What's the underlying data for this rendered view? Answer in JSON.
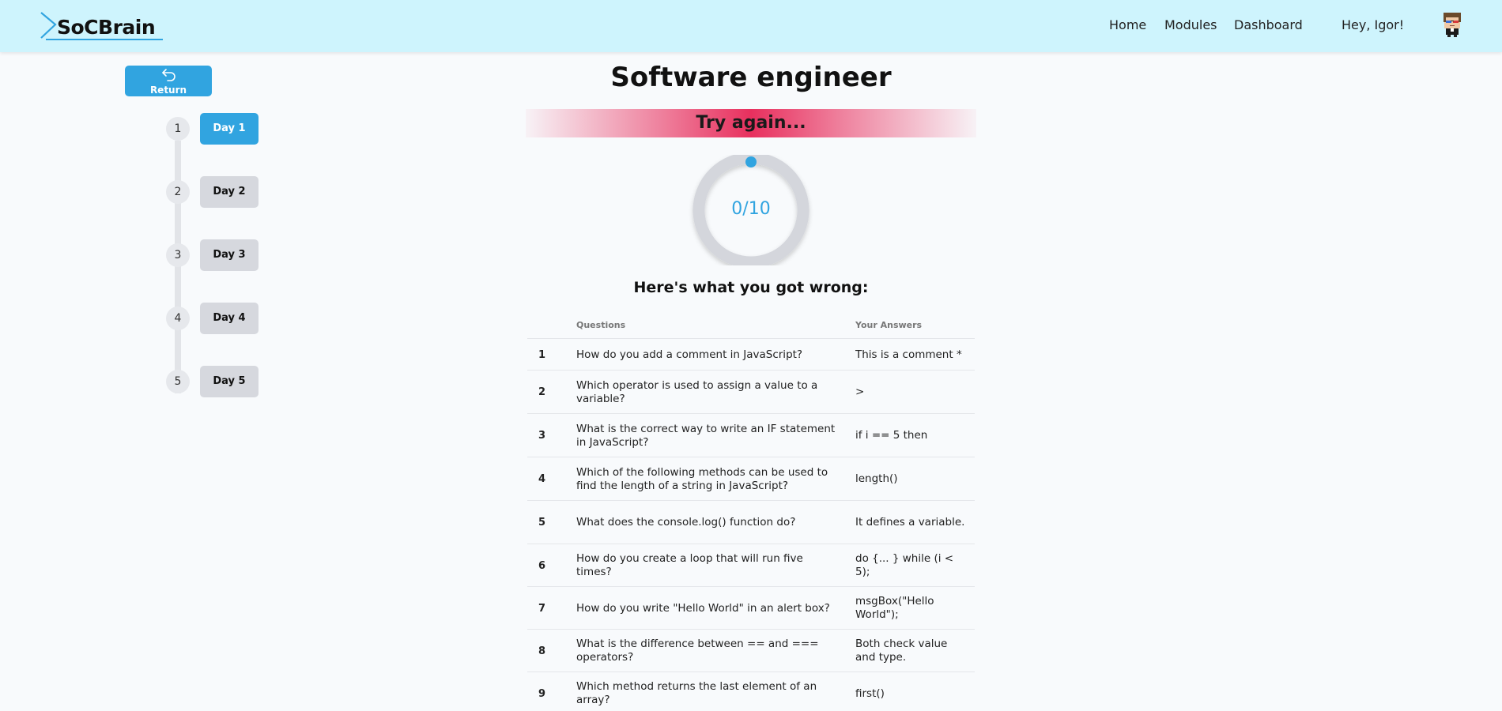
{
  "header": {
    "logo_text": "SoCBrain",
    "nav": [
      "Home",
      "Modules",
      "Dashboard"
    ],
    "greeting": "Hey, Igor!"
  },
  "return_label": "Return",
  "days": [
    {
      "num": "1",
      "label": "Day 1",
      "active": true
    },
    {
      "num": "2",
      "label": "Day 2",
      "active": false
    },
    {
      "num": "3",
      "label": "Day 3",
      "active": false
    },
    {
      "num": "4",
      "label": "Day 4",
      "active": false
    },
    {
      "num": "5",
      "label": "Day 5",
      "active": false
    }
  ],
  "title": "Software engineer",
  "banner": "Try again...",
  "score": {
    "text": "0/10",
    "correct": 0,
    "total": 10
  },
  "wrong_heading": "Here's what you got wrong:",
  "table": {
    "headers": {
      "questions": "Questions",
      "answers": "Your Answers"
    },
    "rows": [
      {
        "num": "1",
        "question": "How do you add a comment in JavaScript?",
        "answer": "This is a comment *"
      },
      {
        "num": "2",
        "question": "Which operator is used to assign a value to a variable?",
        "answer": ">"
      },
      {
        "num": "3",
        "question": "What is the correct way to write an IF statement in JavaScript?",
        "answer": "if i == 5 then"
      },
      {
        "num": "4",
        "question": "Which of the following methods can be used to find the length of a string in JavaScript?",
        "answer": "length()"
      },
      {
        "num": "5",
        "question": "What does the console.log() function do?",
        "answer": "It defines a variable."
      },
      {
        "num": "6",
        "question": "How do you create a loop that will run five times?",
        "answer": "do {... } while (i < 5);"
      },
      {
        "num": "7",
        "question": "How do you write \"Hello World\" in an alert box?",
        "answer": "msgBox(\"Hello World\");"
      },
      {
        "num": "8",
        "question": "What is the difference between == and === operators?",
        "answer": "Both check value and type."
      },
      {
        "num": "9",
        "question": "Which method returns the last element of an array?",
        "answer": "first()"
      }
    ]
  },
  "colors": {
    "header_bg": "#cef4fd",
    "accent": "#31a4e0",
    "banner": "#e8305e",
    "page_bg": "#f8fafc"
  }
}
